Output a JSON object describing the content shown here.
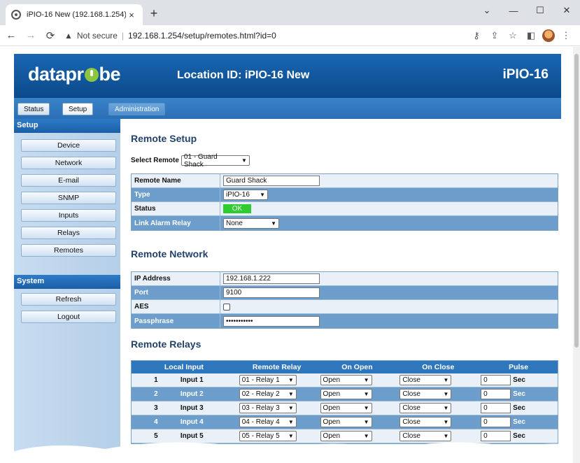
{
  "browser": {
    "tab_title": "iPIO-16 New (192.168.1.254)",
    "tab_close": "×",
    "new_tab": "+",
    "security_label": "Not secure",
    "url": "192.168.1.254/setup/remotes.html?id=0",
    "win_minimize": "—",
    "win_maximize": "☐",
    "win_close": "✕",
    "win_dropdown": "⌄"
  },
  "header": {
    "logo_left": "datapr",
    "logo_right": "be",
    "location": "Location ID: iPIO-16 New",
    "model": "iPIO-16"
  },
  "nav": {
    "tabs": [
      {
        "label": "Status"
      },
      {
        "label": "Setup"
      },
      {
        "label": "Administration"
      }
    ]
  },
  "sidebar": {
    "setup_heading": "Setup",
    "setup_items": [
      {
        "label": "Device"
      },
      {
        "label": "Network"
      },
      {
        "label": "E-mail"
      },
      {
        "label": "SNMP"
      },
      {
        "label": "Inputs"
      },
      {
        "label": "Relays"
      },
      {
        "label": "Remotes"
      }
    ],
    "system_heading": "System",
    "system_items": [
      {
        "label": "Refresh"
      },
      {
        "label": "Logout"
      }
    ]
  },
  "remote_setup": {
    "title": "Remote Setup",
    "select_label": "Select Remote",
    "select_value": "01 - Guard Shack",
    "rows": {
      "name_label": "Remote Name",
      "name_value": "Guard Shack",
      "type_label": "Type",
      "type_value": "iPIO-16",
      "status_label": "Status",
      "status_value": "OK",
      "link_label": "Link Alarm Relay",
      "link_value": "None"
    }
  },
  "remote_network": {
    "title": "Remote Network",
    "rows": {
      "ip_label": "IP Address",
      "ip_value": "192.168.1.222",
      "port_label": "Port",
      "port_value": "9100",
      "aes_label": "AES",
      "pass_label": "Passphrase",
      "pass_value": "•••••••••••"
    }
  },
  "remote_relays": {
    "title": "Remote Relays",
    "headers": {
      "local": "Local Input",
      "remote": "Remote Relay",
      "open": "On Open",
      "close": "On Close",
      "pulse": "Pulse"
    },
    "sec_label": "Sec",
    "rows": [
      {
        "num": "1",
        "input": "Input 1",
        "relay": "01 - Relay 1",
        "open": "Open",
        "close": "Close",
        "pulse": "0"
      },
      {
        "num": "2",
        "input": "Input 2",
        "relay": "02 - Relay 2",
        "open": "Open",
        "close": "Close",
        "pulse": "0"
      },
      {
        "num": "3",
        "input": "Input 3",
        "relay": "03 - Relay 3",
        "open": "Open",
        "close": "Close",
        "pulse": "0"
      },
      {
        "num": "4",
        "input": "Input 4",
        "relay": "04 - Relay 4",
        "open": "Open",
        "close": "Close",
        "pulse": "0"
      },
      {
        "num": "5",
        "input": "Input 5",
        "relay": "05 - Relay 5",
        "open": "Open",
        "close": "Close",
        "pulse": "0"
      }
    ]
  },
  "colors": {
    "header_blue": "#0b4a8a",
    "nav_blue": "#2a6fb4",
    "row_blue": "#6d9ecb",
    "status_green": "#2ecc2e",
    "logo_green": "#8cc63f"
  }
}
